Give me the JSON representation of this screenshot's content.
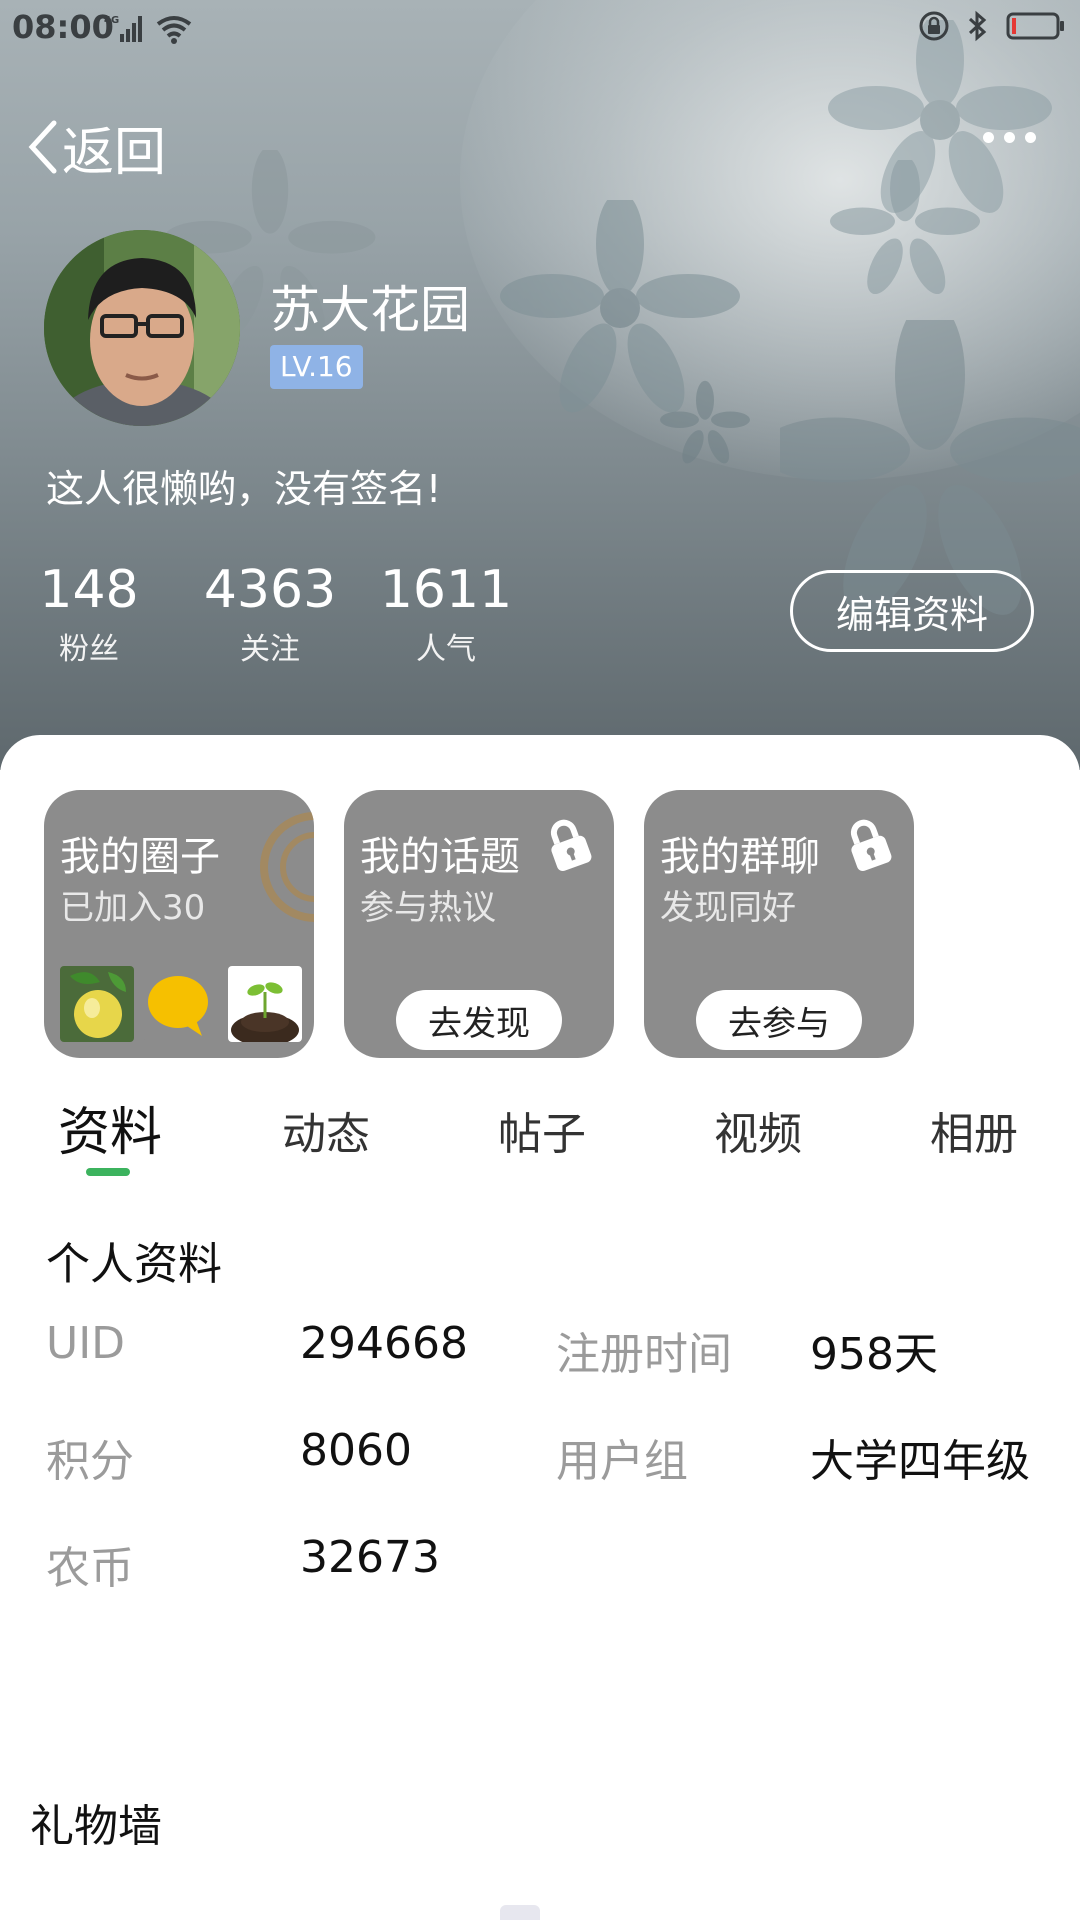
{
  "status_bar": {
    "time": "08:00",
    "network": "4G",
    "icons": [
      "signal-icon",
      "wifi-icon",
      "lock-rotation-icon",
      "bluetooth-icon",
      "battery-low-icon"
    ],
    "battery_color": "#e53935"
  },
  "nav": {
    "back_label": "返回"
  },
  "profile": {
    "name": "苏大花园",
    "level": "LV.16",
    "signature": "这人很懒哟，没有签名!",
    "stats": [
      {
        "value": "148",
        "label": "粉丝"
      },
      {
        "value": "4363",
        "label": "关注"
      },
      {
        "value": "1611",
        "label": "人气"
      }
    ],
    "edit_label": "编辑资料"
  },
  "cards": [
    {
      "title": "我的圈子",
      "subtitle": "已加入30"
    },
    {
      "title": "我的话题",
      "subtitle": "参与热议",
      "button": "去发现"
    },
    {
      "title": "我的群聊",
      "subtitle": "发现同好",
      "button": "去参与"
    }
  ],
  "tabs": [
    "资料",
    "动态",
    "帖子",
    "视频",
    "相册"
  ],
  "colors": {
    "accent": "#3cb35e",
    "level_badge": "#8fb3e6",
    "card_bg": "#8c8c8c"
  },
  "info": {
    "title": "个人资料",
    "rows": [
      {
        "label1": "UID",
        "value1": "294668",
        "label2": "注册时间",
        "value2": "958天"
      },
      {
        "label1": "积分",
        "value1": "8060",
        "label2": "用户组",
        "value2": "大学四年级"
      },
      {
        "label1": "农币",
        "value1": "32673"
      }
    ]
  },
  "gift_wall": {
    "title": "礼物墙"
  }
}
